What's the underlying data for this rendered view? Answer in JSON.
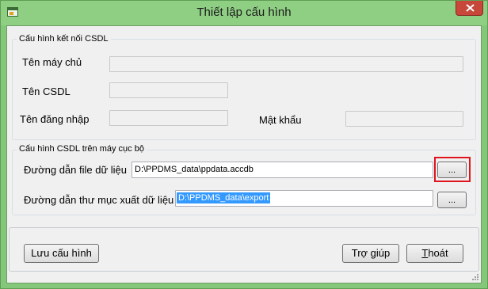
{
  "window": {
    "title": "Thiết lập cấu hình"
  },
  "db_group": {
    "label": "Cấu hình kết nối CSDL",
    "server_label": "Tên máy chủ",
    "server_value": "",
    "db_label": "Tên CSDL",
    "db_value": "",
    "user_label": "Tên đăng nhập",
    "user_value": "",
    "password_label": "Mật khẩu",
    "password_value": ""
  },
  "local_group": {
    "label": "Cấu hình CSDL trên máy cục bộ",
    "file_label": "Đường dẫn file dữ liệu",
    "file_value": "D:\\PPDMS_data\\ppdata.accdb",
    "browse_label": "...",
    "export_label": "Đường dẫn thư mục xuất dữ liệu",
    "export_value": "D:\\PPDMS_data\\export",
    "export_browse_label": "..."
  },
  "footer": {
    "save_label": "Lưu cấu hình",
    "help_label": "Trợ giúp",
    "exit_prefix": "",
    "exit_mnemonic": "T",
    "exit_rest": "hoát"
  },
  "colors": {
    "title_bar": "#8fcf84",
    "close_button": "#c7473a",
    "highlight": "#e0141c",
    "selection": "#3399ff"
  }
}
